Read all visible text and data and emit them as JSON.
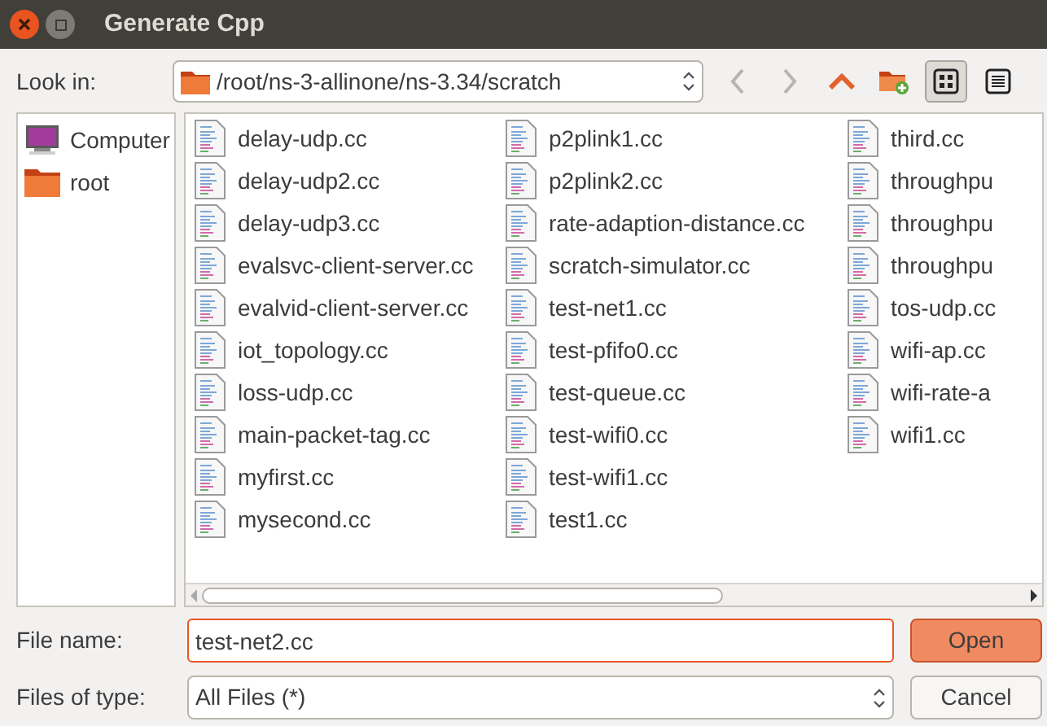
{
  "window": {
    "title": "Generate Cpp"
  },
  "look_in": {
    "label": "Look in:",
    "path": "/root/ns-3-allinone/ns-3.34/scratch"
  },
  "toolbar": [
    {
      "kind": "back",
      "disabled": true
    },
    {
      "kind": "forward",
      "disabled": true
    },
    {
      "kind": "up",
      "disabled": false
    },
    {
      "kind": "new-folder"
    },
    {
      "kind": "icon-view",
      "selected": true
    },
    {
      "kind": "list-view",
      "selected": false
    }
  ],
  "sidebar": {
    "items": [
      {
        "kind": "computer",
        "label": "Computer"
      },
      {
        "kind": "folder",
        "label": "root"
      }
    ]
  },
  "files": {
    "columns": [
      [
        "delay-udp.cc",
        "delay-udp2.cc",
        "delay-udp3.cc",
        "evalsvc-client-server.cc",
        "evalvid-client-server.cc",
        "iot_topology.cc",
        "loss-udp.cc",
        "main-packet-tag.cc",
        "myfirst.cc",
        "mysecond.cc"
      ],
      [
        "p2plink1.cc",
        "p2plink2.cc",
        "rate-adaption-distance.cc",
        "scratch-simulator.cc",
        "test-net1.cc",
        "test-pfifo0.cc",
        "test-queue.cc",
        "test-wifi0.cc",
        "test-wifi1.cc",
        "test1.cc"
      ],
      [
        "third.cc",
        "throughpu",
        "throughpu",
        "throughpu",
        "tos-udp.cc",
        "wifi-ap.cc",
        "wifi-rate-a",
        "wifi1.cc"
      ]
    ]
  },
  "file_name": {
    "label": "File name:",
    "value": "test-net2.cc"
  },
  "file_type": {
    "label": "Files of type:",
    "value": "All Files (*)"
  },
  "buttons": [
    {
      "kind": "primary",
      "label": "Open"
    },
    {
      "kind": "normal",
      "label": "Cancel"
    }
  ]
}
